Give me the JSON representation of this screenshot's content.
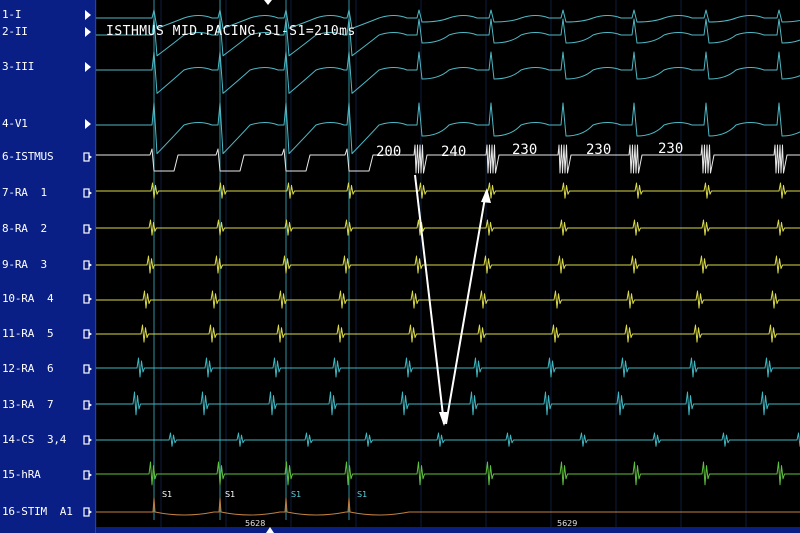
{
  "channels": [
    {
      "label": "1-I",
      "icon": "play-triangle-icon"
    },
    {
      "label": "2-II",
      "icon": "play-triangle-icon"
    },
    {
      "label": "3-III",
      "icon": "play-triangle-icon"
    },
    {
      "label": "4-V1",
      "icon": "play-triangle-icon"
    },
    {
      "label": "6-ISTMUS",
      "icon": "electrode-icon"
    },
    {
      "label": "7-RA  1",
      "icon": "electrode-icon"
    },
    {
      "label": "8-RA  2",
      "icon": "electrode-icon"
    },
    {
      "label": "9-RA  3",
      "icon": "electrode-icon"
    },
    {
      "label": "10-RA  4",
      "icon": "electrode-icon"
    },
    {
      "label": "11-RA  5",
      "icon": "electrode-icon"
    },
    {
      "label": "12-RA  6",
      "icon": "electrode-icon"
    },
    {
      "label": "13-RA  7",
      "icon": "electrode-icon"
    },
    {
      "label": "14-CS  3,4",
      "icon": "electrode-icon"
    },
    {
      "label": "15-hRA",
      "icon": "electrode-icon"
    },
    {
      "label": "16-STIM  A1",
      "icon": "electrode-icon"
    }
  ],
  "annotation": "ISTHMUS MID.PACING,S1-S1=210ms",
  "intervals": [
    "200",
    "240",
    "230",
    "230",
    "230"
  ],
  "stim_labels": [
    "S1",
    "S1",
    "S1",
    "S1"
  ],
  "page_numbers": [
    "5628",
    "5629"
  ],
  "colors": {
    "sidebar": "#0a1f86",
    "ecg": "#4fb8c4",
    "istmus": "#e8e8e8",
    "ra_yellow": "#d8d84a",
    "ra_cyan": "#3fb6c0",
    "hra": "#5fbf3f",
    "stim": "#c08040",
    "grid": "#16306a"
  }
}
